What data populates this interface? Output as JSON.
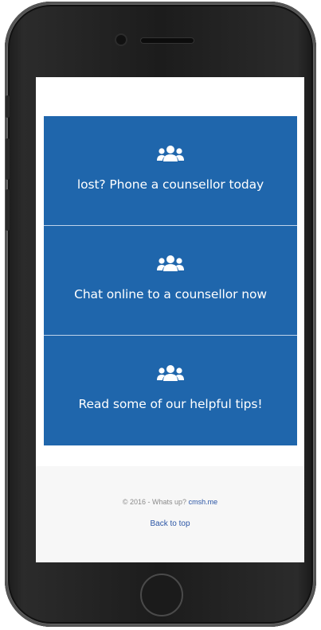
{
  "tiles": [
    {
      "label": "lost? Phone a counsellor today",
      "icon": "users-icon"
    },
    {
      "label": "Chat online to a counsellor now",
      "icon": "users-icon"
    },
    {
      "label": "Read some of our helpful tips!",
      "icon": "users-icon"
    }
  ],
  "footer": {
    "copyright_prefix": "© 2016 - Whats up?",
    "site_link": "cmsh.me",
    "back_to_top": "Back to top"
  },
  "colors": {
    "tile_bg": "#1f66ac",
    "link": "#2a55a5",
    "footer_bg": "#f7f7f7"
  }
}
